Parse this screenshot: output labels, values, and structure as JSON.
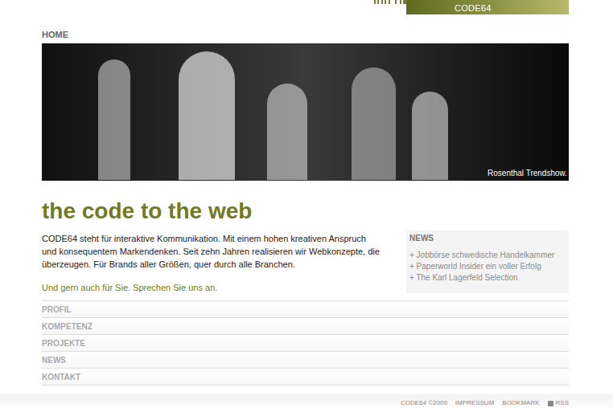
{
  "logo": {
    "text": "CODE64"
  },
  "topnav": {
    "home": "HOME"
  },
  "hero": {
    "caption": "Rosenthal Trendshow."
  },
  "headline": "the code to the web",
  "intro": "CODE64 steht für interaktive Kommunikation. Mit einem hohen kreativen Anspruch und konsequentem Markendenken. Seit zehn Jahren realisieren wir Webkonzepte, die überzeugen. Für Brands aller Größen, quer durch alle Branchen.",
  "cta": "Und gern auch für Sie. Sprechen Sie uns an.",
  "news": {
    "title": "NEWS",
    "items": [
      "+ Jobbörse schwedische Handelkammer",
      "+ Paperworld Insider ein voller Erfolg",
      "+ The Karl Lagerfeld Selection"
    ]
  },
  "menu": [
    "PROFIL",
    "KOMPETENZ",
    "PROJEKTE",
    "NEWS",
    "KONTAKT"
  ],
  "footer": {
    "items": [
      "CODE64 ©2009",
      "IMPRESSUM",
      "BOOKMARK",
      "RSS"
    ]
  }
}
